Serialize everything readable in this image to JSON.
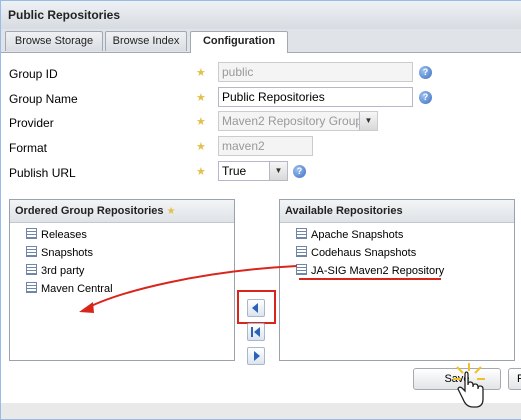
{
  "panel": {
    "title": "Public Repositories"
  },
  "tabs": [
    {
      "label": "Browse Storage"
    },
    {
      "label": "Browse Index"
    },
    {
      "label": "Configuration"
    }
  ],
  "form": {
    "group_id": {
      "label": "Group ID",
      "value": "public"
    },
    "group_name": {
      "label": "Group Name",
      "value": "Public Repositories"
    },
    "provider": {
      "label": "Provider",
      "value": "Maven2 Repository Group"
    },
    "format": {
      "label": "Format",
      "value": "maven2"
    },
    "publish_url": {
      "label": "Publish URL",
      "value": "True"
    }
  },
  "ordered_group": {
    "title": "Ordered Group Repositories",
    "items": [
      "Releases",
      "Snapshots",
      "3rd party",
      "Maven Central"
    ]
  },
  "available": {
    "title": "Available Repositories",
    "items": [
      "Apache Snapshots",
      "Codehaus Snapshots",
      "JA-SIG Maven2 Repository"
    ]
  },
  "buttons": {
    "save": "Save",
    "reset": "R"
  },
  "colors": {
    "highlight_red": "#d9261c",
    "required_star": "#e3c04a"
  }
}
